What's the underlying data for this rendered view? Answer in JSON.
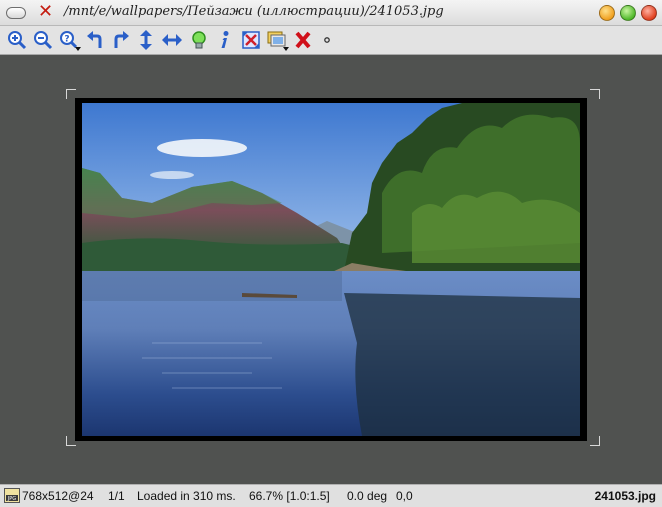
{
  "window": {
    "title": "/mnt/e/wallpapers/Пейзажи (иллюстрации)/241053.jpg"
  },
  "toolbar": {
    "buttons": [
      "zoom-in",
      "zoom-out",
      "zoom-menu",
      "rotate-left",
      "rotate-right",
      "flip-vertical",
      "flip-horizontal",
      "slideshow",
      "info",
      "fit-window",
      "open-with",
      "close",
      "options"
    ]
  },
  "status": {
    "format_icon_label": "JPG",
    "dimensions": "768x512@24",
    "index": "1/1",
    "load_time": "Loaded in 310 ms.",
    "zoom": "66.7% [1.0:1.5]",
    "rotation": "0.0 deg",
    "position": "0,0",
    "filename": "241053.jpg"
  },
  "colors": {
    "canvas_bg": "#505250",
    "close_x": "#c41c10",
    "icon_blue": "#2a5fc8"
  }
}
